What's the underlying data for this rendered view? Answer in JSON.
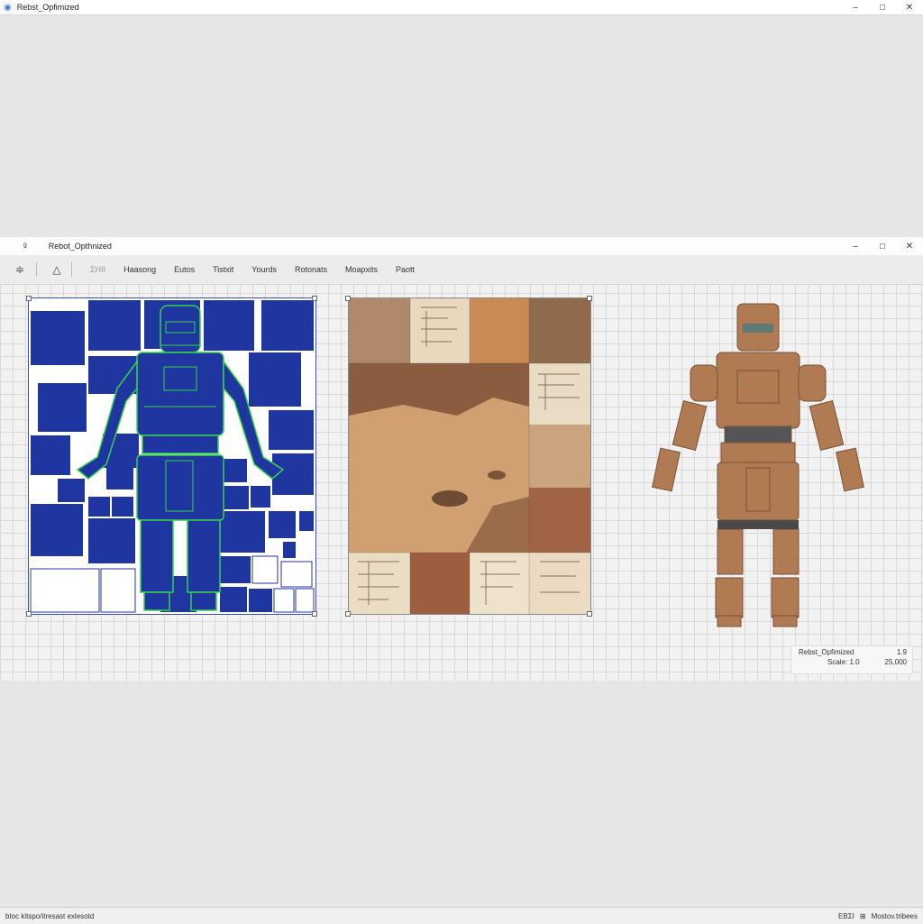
{
  "outer_window": {
    "title": "Rebst_Opfimized",
    "controls": [
      "–",
      "□",
      "✕"
    ]
  },
  "inner_window": {
    "title": "Rebot_Opthnized",
    "controls": [
      "–",
      "□",
      "✕"
    ]
  },
  "toolbar": {
    "tools": [
      "sliders-icon",
      "triangle-icon"
    ],
    "menu": [
      "ΣΗΙΙ",
      "Haasong",
      "Eutos",
      "Tistxit",
      "Yourds",
      "Rotonats",
      "Moapxits",
      "Paott"
    ]
  },
  "info_box": {
    "name": "Rebst_Opfimized",
    "version": "1.9",
    "scale": "Scale: 1.0",
    "count": "25,000"
  },
  "status_bar": {
    "left": "btoc kitspo/itresast exlesotd",
    "right_code": "ΕΒΣΙ",
    "right_text": "Mostov.tribees"
  },
  "colors": {
    "uv_blue": "#1f35a0",
    "uv_wire": "#35d24a",
    "robot_base": "#b07a52"
  }
}
